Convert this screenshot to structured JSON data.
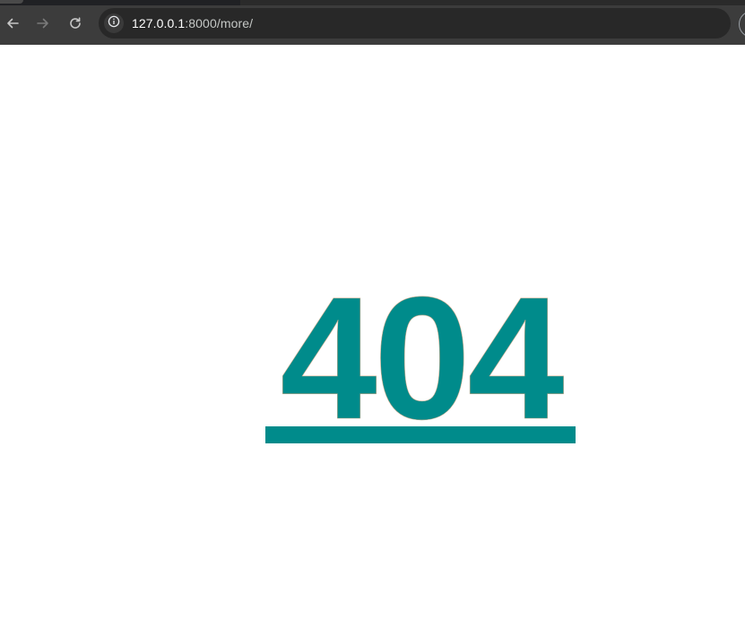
{
  "browser": {
    "address_bar": {
      "host": "127.0.0.1",
      "rest": ":8000/more/"
    },
    "icons": {
      "back": "arrow-left-icon",
      "forward": "arrow-right-icon",
      "reload": "reload-icon",
      "site_info": "info-icon"
    }
  },
  "page": {
    "error_code": "404"
  },
  "colors": {
    "accent": "#008b8b",
    "chrome_bg": "#3c3c3c",
    "omnibox_bg": "#282828"
  }
}
